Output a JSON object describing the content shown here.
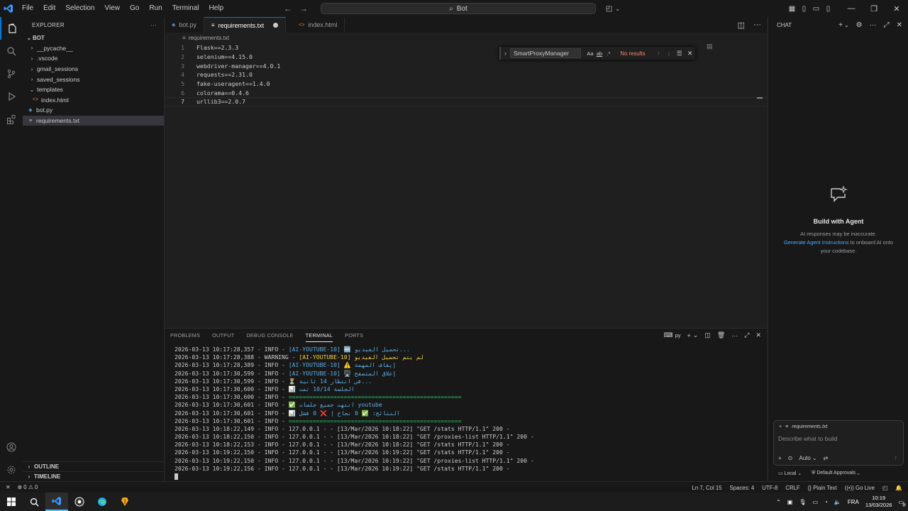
{
  "titlebar": {
    "menu": [
      "File",
      "Edit",
      "Selection",
      "View",
      "Go",
      "Run",
      "Terminal",
      "Help"
    ],
    "search_text": "Bot"
  },
  "explorer": {
    "title": "EXPLORER",
    "root": "BOT",
    "items": [
      {
        "label": "__pycache__",
        "type": "folder"
      },
      {
        "label": ".vscode",
        "type": "folder"
      },
      {
        "label": "gmail_sessions",
        "type": "folder"
      },
      {
        "label": "saved_sessions",
        "type": "folder"
      },
      {
        "label": "templates",
        "type": "folder-open"
      },
      {
        "label": "index.html",
        "type": "html"
      },
      {
        "label": "bot.py",
        "type": "python"
      },
      {
        "label": "requirements.txt",
        "type": "text"
      }
    ],
    "outline": "OUTLINE",
    "timeline": "TIMELINE"
  },
  "editor": {
    "tabs": [
      {
        "label": "bot.py"
      },
      {
        "label": "requirements.txt"
      },
      {
        "label": "index.html"
      }
    ],
    "breadcrumb": "requirements.txt",
    "lines": [
      {
        "n": "1",
        "text": "Flask==2.3.3"
      },
      {
        "n": "2",
        "text": "selenium==4.15.0"
      },
      {
        "n": "3",
        "text": "webdriver-manager==4.0.1"
      },
      {
        "n": "4",
        "text": "requests==2.31.0"
      },
      {
        "n": "5",
        "text": "fake-useragent==1.4.0"
      },
      {
        "n": "6",
        "text": "colorama==0.4.6"
      },
      {
        "n": "7",
        "text": "urllib3==2.0.7"
      }
    ],
    "find": {
      "value": "SmartProxyManager",
      "opt_case": "Aa",
      "opt_word": "ab",
      "opt_regex": ".*",
      "result": "No results"
    }
  },
  "panel": {
    "tabs": [
      "PROBLEMS",
      "OUTPUT",
      "DEBUG CONSOLE",
      "TERMINAL",
      "PORTS"
    ],
    "shell": "py",
    "terminal": [
      {
        "ts": "2026-03-13 10:17:28,357 - INFO - ",
        "tag": "[AI-YOUTUBE-10]",
        "msg": " 🆕 تحميل الفيديو..."
      },
      {
        "ts": "2026-03-13 10:17:28,388 - WARNING - ",
        "tag": "[AI-YOUTUBE-10]",
        "msg": " لم يتم تحميل الفيديو"
      },
      {
        "ts": "2026-03-13 10:17:28,389 - INFO - ",
        "tag": "[AI-YOUTUBE-10]",
        "msg": " ⚠️ إيقاف المهمة"
      },
      {
        "ts": "2026-03-13 10:17:30,599 - INFO - ",
        "tag": "[AI-YOUTUBE-10]",
        "msg": " 🖥️ إغلاق المتصفح"
      },
      {
        "ts": "2026-03-13 10:17:30,599 - INFO - ",
        "tag": "",
        "msg": "⏳ في انتظار 14 ثانية..."
      },
      {
        "ts": "2026-03-13 10:17:30,600 - INFO - ",
        "tag": "",
        "msg": "📊 الجلسة 10/14 تمت"
      },
      {
        "ts": "2026-03-13 10:17:30,600 - INFO - ",
        "tag": "",
        "msg": "",
        "sep": "=================================================="
      },
      {
        "ts": "2026-03-13 10:17:30,601 - INFO - ",
        "tag": "",
        "msg": "✅ انتهت جميع جلسات youtube"
      },
      {
        "ts": "2026-03-13 10:17:30,601 - INFO - ",
        "tag": "",
        "msg": "📊 النتائج: ✅ 0 نجاح | ❌ 0 فشل"
      },
      {
        "ts": "2026-03-13 10:17:30,601 - INFO - ",
        "tag": "",
        "msg": "",
        "sep": "=================================================="
      },
      {
        "ts": "2026-03-13 10:18:22,149 - INFO - 127.0.0.1 - - [13/Mar/2026 10:18:22] \"GET /stats HTTP/1.1\" 200 -",
        "tag": "",
        "msg": ""
      },
      {
        "ts": "2026-03-13 10:18:22,150 - INFO - 127.0.0.1 - - [13/Mar/2026 10:18:22] \"GET /proxies-list HTTP/1.1\" 200 -",
        "tag": "",
        "msg": ""
      },
      {
        "ts": "2026-03-13 10:18:22,153 - INFO - 127.0.0.1 - - [13/Mar/2026 10:18:22] \"GET /stats HTTP/1.1\" 200 -",
        "tag": "",
        "msg": ""
      },
      {
        "ts": "2026-03-13 10:19:22,150 - INFO - 127.0.0.1 - - [13/Mar/2026 10:19:22] \"GET /stats HTTP/1.1\" 200 -",
        "tag": "",
        "msg": ""
      },
      {
        "ts": "2026-03-13 10:19:22,150 - INFO - 127.0.0.1 - - [13/Mar/2026 10:19:22] \"GET /proxies-list HTTP/1.1\" 200 -",
        "tag": "",
        "msg": ""
      },
      {
        "ts": "2026-03-13 10:19:22,156 - INFO - 127.0.0.1 - - [13/Mar/2026 10:19:22] \"GET /stats HTTP/1.1\" 200 -",
        "tag": "",
        "msg": ""
      }
    ]
  },
  "chat": {
    "title": "CHAT",
    "empty_title": "Build with Agent",
    "empty_desc_1": "AI responses may be inaccurate.",
    "empty_link": "Generate Agent Instructions",
    "empty_desc_2": " to onboard AI onto your codebase.",
    "context_chip": "requirements.txt",
    "placeholder": "Describe what to build",
    "mode": "Auto",
    "local": "Local",
    "approvals": "Default Approvals"
  },
  "statusbar": {
    "errors": "0",
    "warnings": "0",
    "position": "Ln 7, Col 15",
    "spaces": "Spaces: 4",
    "encoding": "UTF-8",
    "eol": "CRLF",
    "language": "Plain Text",
    "golive": "Go Live"
  },
  "taskbar": {
    "lang": "FRA",
    "time": "10:19",
    "date": "13/03/2026",
    "badge": "9"
  },
  "colors": {
    "accent": "#0078d4",
    "editor_bg": "#1f1f1f",
    "sidebar_bg": "#181818",
    "warning_tag": "#f4d03f",
    "no_results": "#f48771",
    "link": "#4daafc"
  }
}
